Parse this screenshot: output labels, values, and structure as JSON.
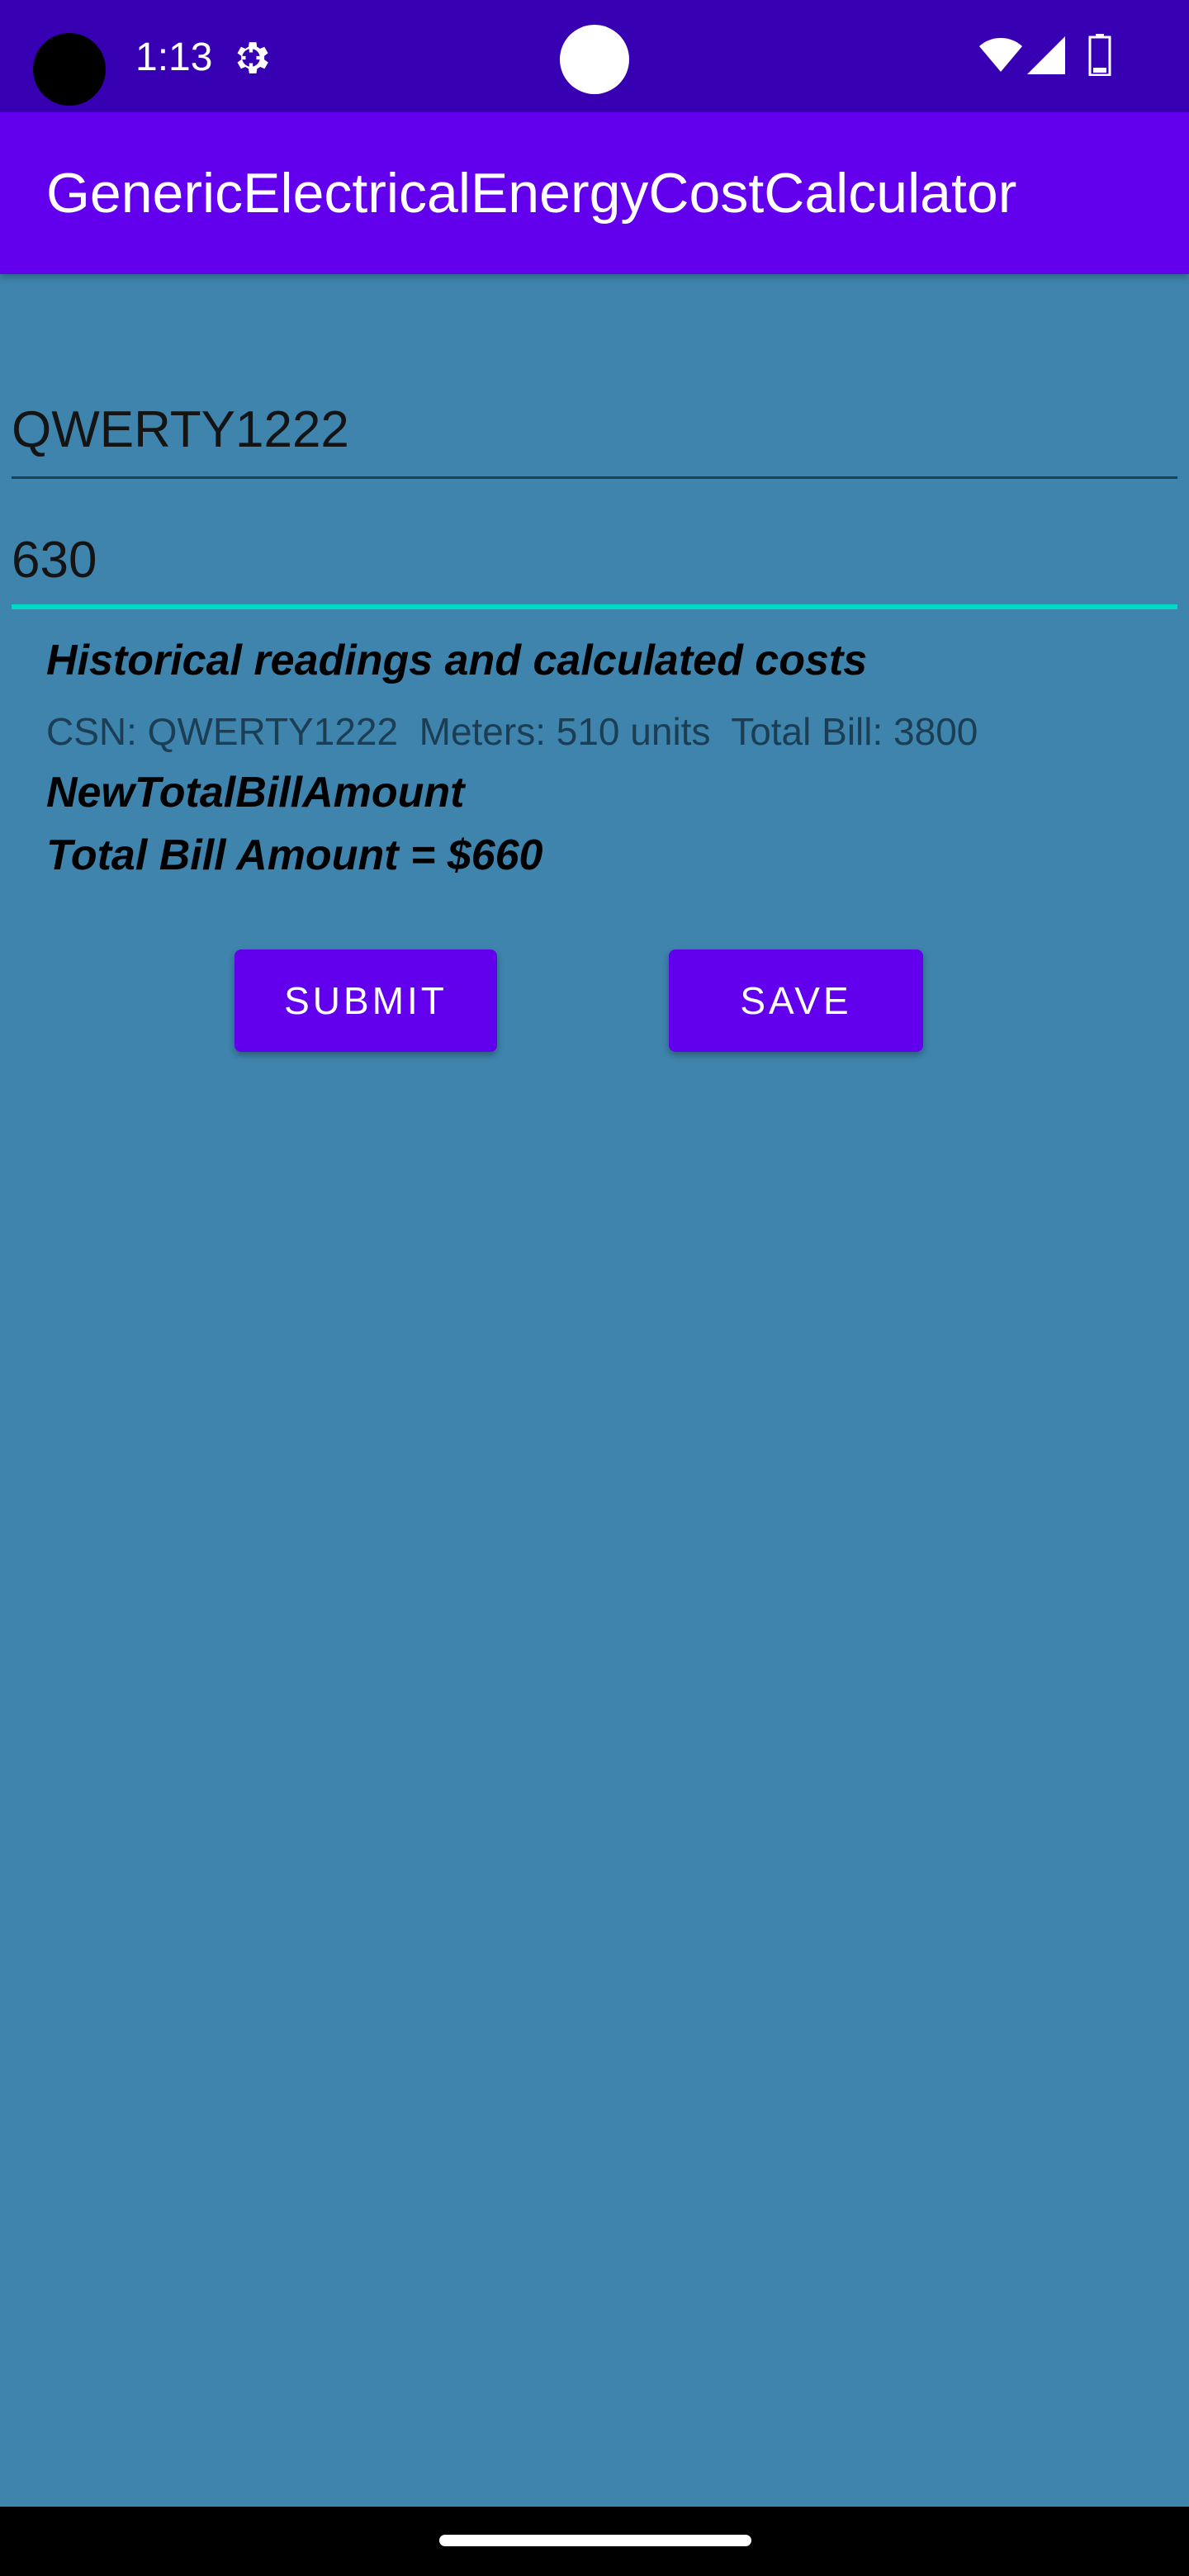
{
  "status_bar": {
    "time": "1:13",
    "icons": [
      "settings-icon",
      "wifi-icon",
      "signal-icon",
      "battery-icon"
    ]
  },
  "app_bar": {
    "title": "GenericElectricalEnergyCostCalculator"
  },
  "form": {
    "csn_value": "QWERTY1222",
    "units_value": "630"
  },
  "history": {
    "title": "Historical readings and calculated costs",
    "row": "CSN: QWERTY1222  Meters: 510 units  Total Bill: 3800"
  },
  "result": {
    "label": "NewTotalBillAmount",
    "total_text": "Total Bill Amount = $660"
  },
  "buttons": {
    "submit_label": "SUBMIT",
    "save_label": "SAVE"
  },
  "colors": {
    "status_bar": "#3700b3",
    "app_bar": "#6200ee",
    "background": "#3e84ad",
    "accent": "#03dac5",
    "button": "#6200ee"
  }
}
